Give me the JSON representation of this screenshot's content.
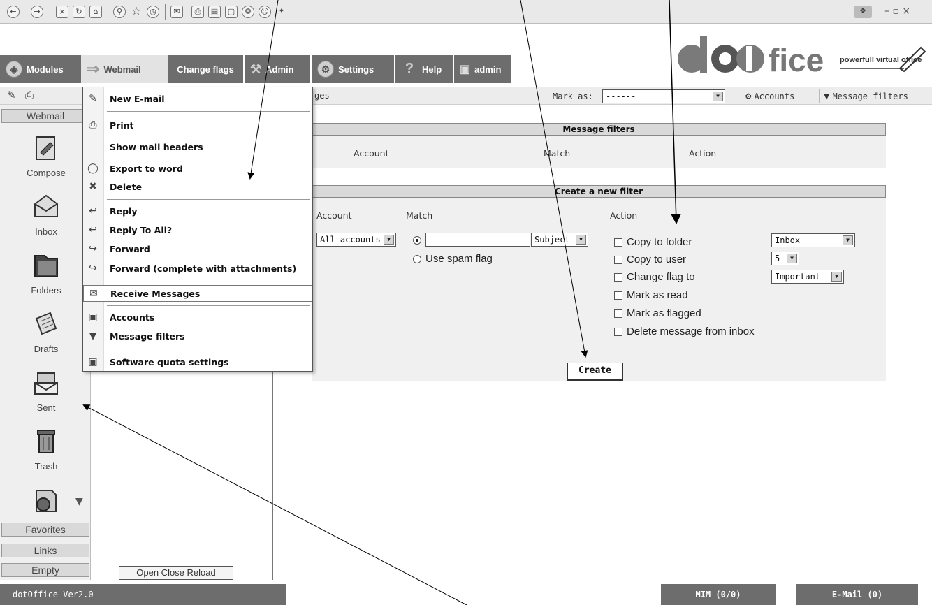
{
  "browser": {
    "icons": [
      "back-icon",
      "forward-icon",
      "stop-icon",
      "refresh-icon",
      "home-icon",
      "search-icon",
      "favorites-icon",
      "history-icon",
      "mail-icon",
      "print-icon",
      "edit-icon",
      "discuss-icon",
      "research-icon",
      "messenger-icon",
      "extra-icon"
    ],
    "window_controls": "– ▫ ×"
  },
  "tabs": [
    {
      "label": "Modules",
      "icon": "cube-icon"
    },
    {
      "label": "Webmail",
      "icon": "arrow-right-icon"
    },
    {
      "label": "Change flags",
      "icon": ""
    },
    {
      "label": "Admin",
      "icon": "wrench-icon"
    },
    {
      "label": "Settings",
      "icon": "gear-icon"
    },
    {
      "label": "Help",
      "icon": "question-icon"
    },
    {
      "label": "admin",
      "icon": "lock-icon"
    }
  ],
  "logo": {
    "text": "dotoffice",
    "tagline": "powerfull virtual office"
  },
  "toolbar": {
    "partial_label": "ges",
    "mark_as_label": "Mark as:",
    "mark_as_value": "------",
    "accounts_label": "Accounts",
    "filters_label": "Message filters"
  },
  "leftnav": {
    "header": "Webmail",
    "items": [
      {
        "label": "Compose",
        "icon": "compose-icon"
      },
      {
        "label": "Inbox",
        "icon": "inbox-icon"
      },
      {
        "label": "Folders",
        "icon": "folders-icon"
      },
      {
        "label": "Drafts",
        "icon": "drafts-icon"
      },
      {
        "label": "Sent",
        "icon": "sent-icon"
      },
      {
        "label": "Trash",
        "icon": "trash-icon"
      },
      {
        "label": "",
        "icon": "globe-icon"
      }
    ],
    "bottom_tabs": [
      "Favorites",
      "Links",
      "Empty"
    ],
    "open_close_reload": "Open Close Reload"
  },
  "menu": {
    "items": [
      {
        "label": "New E-mail",
        "icon": "new-email-icon"
      },
      {
        "label": "Print",
        "icon": "print-icon"
      },
      {
        "label": "Show mail headers",
        "icon": ""
      },
      {
        "label": "Export to word",
        "icon": "export-word-icon"
      },
      {
        "label": "Delete",
        "icon": "delete-icon"
      },
      {
        "label": "Reply",
        "icon": "reply-icon"
      },
      {
        "label": "Reply To All?",
        "icon": "reply-all-icon"
      },
      {
        "label": "Forward",
        "icon": "forward-icon"
      },
      {
        "label": "Forward (complete with attachments)",
        "icon": "forward-attach-icon"
      },
      {
        "label": "Receive Messages",
        "icon": "receive-icon"
      },
      {
        "label": "Accounts",
        "icon": "accounts-icon"
      },
      {
        "label": "Message filters",
        "icon": "filter-icon"
      },
      {
        "label": "Software quota settings",
        "icon": "quota-icon"
      }
    ]
  },
  "filters": {
    "title": "Message filters",
    "columns": [
      "Account",
      "Match",
      "Action"
    ]
  },
  "create": {
    "title": "Create a new filter",
    "columns": [
      "Account",
      "Match",
      "Action"
    ],
    "account_value": "All accounts",
    "match_text_value": "",
    "match_field": "Subject",
    "spam_label": "Use spam flag",
    "actions": [
      {
        "label": "Copy to folder",
        "option": "Inbox"
      },
      {
        "label": "Copy to user",
        "option": "5"
      },
      {
        "label": "Change flag to",
        "option": "Important"
      },
      {
        "label": "Mark as read",
        "option": ""
      },
      {
        "label": "Mark as flagged",
        "option": ""
      },
      {
        "label": "Delete message from inbox",
        "option": ""
      }
    ],
    "button": "Create"
  },
  "footer": {
    "version": "dotOffice Ver2.0",
    "mim": "MIM (0/0)",
    "email": "E-Mail (0)"
  }
}
